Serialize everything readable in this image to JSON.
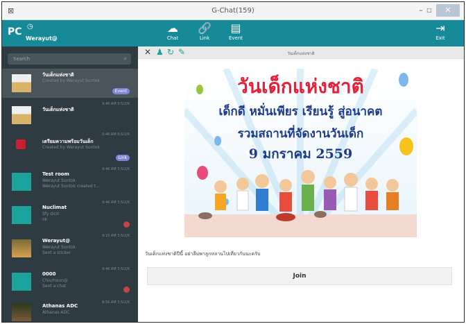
{
  "window": {
    "title": "G-Chat(159)",
    "app_icon": "windows-app-icon",
    "minimize": "–",
    "maximize": "□",
    "close": "✕"
  },
  "header": {
    "logo": "PC",
    "username": "Werayut@",
    "nav": [
      {
        "label": "Chat",
        "icon": "cloud-chat-icon"
      },
      {
        "label": "Link",
        "icon": "link-icon"
      },
      {
        "label": "Event",
        "icon": "calendar-icon"
      }
    ],
    "exit_label": "Exit"
  },
  "sidebar": {
    "search_placeholder": "Search",
    "chats": [
      {
        "title": "วันเด็กแห่งชาติ",
        "subtitle": "Created by Werayut Suntok",
        "time": "",
        "badge": "Event"
      },
      {
        "title": "วันเด็กแห่งชาติ",
        "subtitle": "",
        "time": "9:46 AM 9:5/2/6",
        "badge": ""
      },
      {
        "title": "เตรียมความพร้อมวันเด็ก",
        "subtitle": "Created by Werayut Suntok",
        "time": "9:46 AM 9:5/2/6",
        "badge": "Link"
      },
      {
        "title": "Test room",
        "subtitle": "Werayut Suntok",
        "subtitle2": "Werayut Suntok created t...",
        "time": "9:46 AM 3:5/2/6",
        "badge": ""
      },
      {
        "title": "Nuclimat",
        "subtitle": "Sfy dicit",
        "subtitle2": "ok",
        "time": "9:46 AM 3:5/2/6",
        "badge": ""
      },
      {
        "title": "Werayut@",
        "subtitle": "Werayut Suntok",
        "subtitle2": "Sent a sticker",
        "time": "9:15 AM 3:5/2/6",
        "badge": ""
      },
      {
        "title": "0000",
        "subtitle": "Chiurhoun@",
        "subtitle2": "Sent a chat",
        "time": "9:46 AM 3:5/2/6",
        "badge": ""
      },
      {
        "title": "Athanas ADC",
        "subtitle": "Athanas ADC",
        "time": "8:56 AM 3:5/2/6",
        "badge": ""
      }
    ]
  },
  "main": {
    "toolbar_title": "วันเด็กแห่งชาติ",
    "banner": {
      "line1": "วันเด็กแห่งชาติ",
      "line2": "เด็กดี หมั่นเพียร เรียนรู้ สู่อนาคต",
      "line3": "รวมสถานที่จัดงานวันเด็ก",
      "line4": "9 มกราคม 2559"
    },
    "caption": "วันเด็กแห่งชาติปีนี้ อย่าลืมพาลูกหลานไปเที่ยวกันนะครับ",
    "join_label": "Join"
  },
  "colors": {
    "topbar": "#168a99",
    "sidebar": "#2f3b43",
    "selected_row": "#49545b",
    "badge": "#7d86d8",
    "alert_dot": "#c24444"
  }
}
